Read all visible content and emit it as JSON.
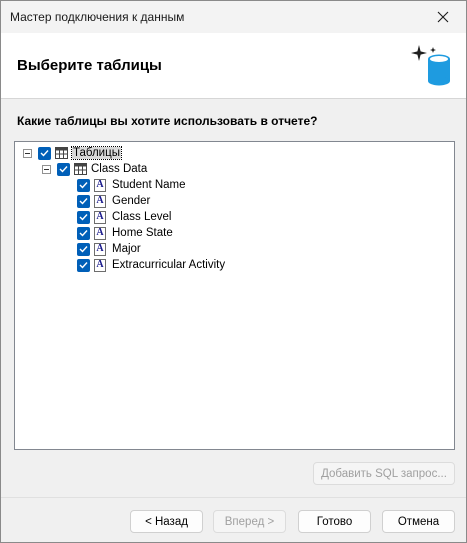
{
  "window": {
    "title": "Мастер подключения к данным"
  },
  "header": {
    "title": "Выберите таблицы"
  },
  "main": {
    "question": "Какие таблицы вы хотите использовать в отчете?"
  },
  "tree": {
    "root_label": "Таблицы",
    "table_label": "Class Data",
    "fields": [
      {
        "label": "Student Name"
      },
      {
        "label": "Gender"
      },
      {
        "label": "Class Level"
      },
      {
        "label": "Home State"
      },
      {
        "label": "Major"
      },
      {
        "label": "Extracurricular Activity"
      }
    ]
  },
  "buttons": {
    "add_sql": "Добавить SQL запрос...",
    "back": "< Назад",
    "next": "Вперед >",
    "finish": "Готово",
    "cancel": "Отмена"
  },
  "icons": {
    "close": "close-icon",
    "wizard": "database-sparkle-icon",
    "collapse": "collapse-icon",
    "checkbox": "checkbox-checked-icon",
    "table": "table-grid-icon",
    "field": "text-field-icon"
  },
  "colors": {
    "accent": "#005fb8",
    "database": "#1e9be0",
    "header_bg": "#ffffff",
    "window_bg": "#f0f0f0"
  }
}
